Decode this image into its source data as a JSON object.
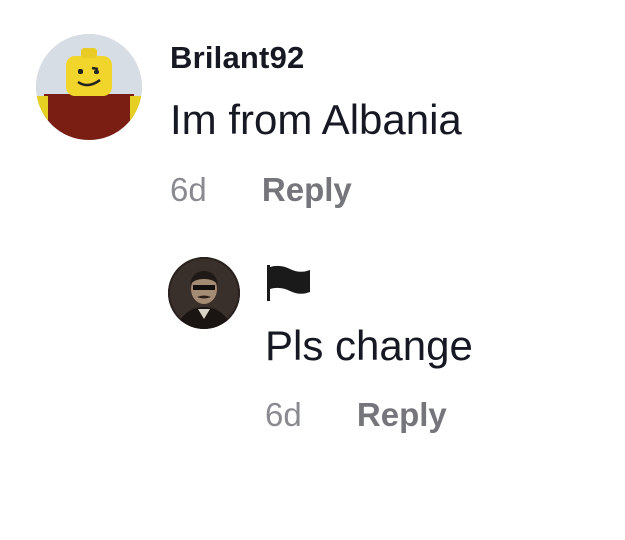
{
  "comment": {
    "username": "Brilant92",
    "text": "Im from Albania",
    "time": "6d",
    "reply_label": "Reply",
    "avatar": "roblox-avatar"
  },
  "reply": {
    "username_icon": "black-flag-icon",
    "text": "Pls change",
    "time": "6d",
    "reply_label": "Reply",
    "avatar": "portrait-avatar"
  },
  "colors": {
    "primary_text": "#161823",
    "secondary_text": "#8a8b91",
    "reply_link": "#75767c",
    "background": "#ffffff"
  }
}
